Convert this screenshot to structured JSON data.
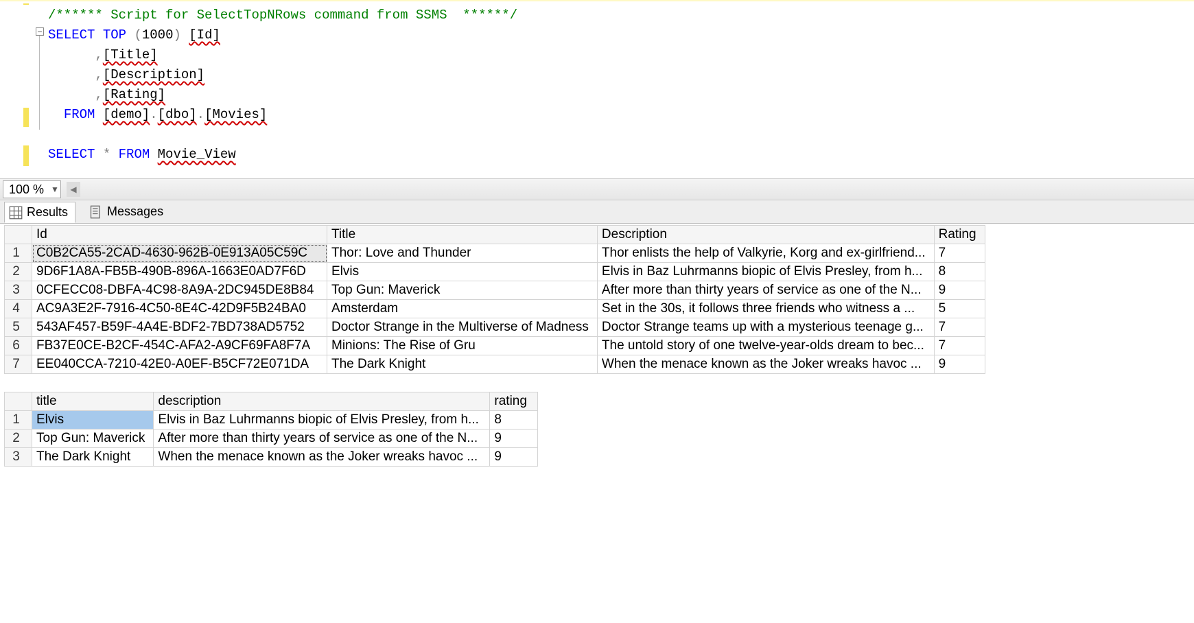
{
  "editor": {
    "lines": [
      {
        "seg": [
          {
            "t": "/****** Script for SelectTopNRows command from SSMS  ******/",
            "c": "cmt"
          }
        ]
      },
      {
        "seg": [
          {
            "t": "SELECT",
            "c": "kw"
          },
          {
            "t": " ",
            "c": "txt"
          },
          {
            "t": "TOP",
            "c": "kw"
          },
          {
            "t": " ",
            "c": "txt"
          },
          {
            "t": "(",
            "c": "op"
          },
          {
            "t": "1000",
            "c": "txt"
          },
          {
            "t": ")",
            "c": "op"
          },
          {
            "t": " ",
            "c": "txt"
          },
          {
            "t": "[Id]",
            "c": "txt squig"
          }
        ]
      },
      {
        "seg": [
          {
            "t": "      ",
            "c": "txt"
          },
          {
            "t": ",",
            "c": "op"
          },
          {
            "t": "[Title]",
            "c": "txt squig"
          }
        ]
      },
      {
        "seg": [
          {
            "t": "      ",
            "c": "txt"
          },
          {
            "t": ",",
            "c": "op"
          },
          {
            "t": "[Description]",
            "c": "txt squig"
          }
        ]
      },
      {
        "seg": [
          {
            "t": "      ",
            "c": "txt"
          },
          {
            "t": ",",
            "c": "op"
          },
          {
            "t": "[Rating]",
            "c": "txt squig"
          }
        ]
      },
      {
        "seg": [
          {
            "t": "  ",
            "c": "txt"
          },
          {
            "t": "FROM",
            "c": "kw"
          },
          {
            "t": " ",
            "c": "txt"
          },
          {
            "t": "[demo]",
            "c": "txt squig"
          },
          {
            "t": ".",
            "c": "op"
          },
          {
            "t": "[dbo]",
            "c": "txt squig"
          },
          {
            "t": ".",
            "c": "op"
          },
          {
            "t": "[Movies]",
            "c": "txt squig"
          }
        ]
      },
      {
        "seg": [
          {
            "t": " ",
            "c": "txt"
          }
        ]
      },
      {
        "seg": [
          {
            "t": "SELECT",
            "c": "kw"
          },
          {
            "t": " ",
            "c": "txt"
          },
          {
            "t": "*",
            "c": "op"
          },
          {
            "t": " ",
            "c": "txt"
          },
          {
            "t": "FROM",
            "c": "kw"
          },
          {
            "t": " ",
            "c": "txt"
          },
          {
            "t": "Movie_View",
            "c": "txt squig"
          }
        ]
      }
    ]
  },
  "zoom": {
    "value": "100 %"
  },
  "tabs": {
    "results": "Results",
    "messages": "Messages"
  },
  "grid1": {
    "headers": {
      "id": "Id",
      "title": "Title",
      "desc": "Description",
      "rating": "Rating"
    },
    "rows": [
      {
        "n": "1",
        "id": "C0B2CA55-2CAD-4630-962B-0E913A05C59C",
        "title": "Thor: Love and Thunder",
        "desc": "Thor enlists the help of Valkyrie, Korg and ex-girlfriend...",
        "rating": "7"
      },
      {
        "n": "2",
        "id": "9D6F1A8A-FB5B-490B-896A-1663E0AD7F6D",
        "title": "Elvis",
        "desc": "Elvis in Baz Luhrmanns biopic of Elvis Presley, from h...",
        "rating": "8"
      },
      {
        "n": "3",
        "id": "0CFECC08-DBFA-4C98-8A9A-2DC945DE8B84",
        "title": "Top Gun: Maverick",
        "desc": "After more than thirty years of service as one of the N...",
        "rating": "9"
      },
      {
        "n": "4",
        "id": "AC9A3E2F-7916-4C50-8E4C-42D9F5B24BA0",
        "title": "Amsterdam",
        "desc": "Set in the 30s, it follows three friends who witness a ...",
        "rating": "5"
      },
      {
        "n": "5",
        "id": "543AF457-B59F-4A4E-BDF2-7BD738AD5752",
        "title": "Doctor Strange in the Multiverse of Madness",
        "desc": "Doctor Strange teams up with a mysterious teenage g...",
        "rating": "7"
      },
      {
        "n": "6",
        "id": "FB37E0CE-B2CF-454C-AFA2-A9CF69FA8F7A",
        "title": "Minions: The Rise of Gru",
        "desc": "The untold story of one twelve-year-olds dream to bec...",
        "rating": "7"
      },
      {
        "n": "7",
        "id": "EE040CCA-7210-42E0-A0EF-B5CF72E071DA",
        "title": "The Dark Knight",
        "desc": "When the menace known as the Joker wreaks havoc ...",
        "rating": "9"
      }
    ]
  },
  "grid2": {
    "headers": {
      "title": "title",
      "desc": "description",
      "rating": "rating"
    },
    "rows": [
      {
        "n": "1",
        "title": "Elvis",
        "desc": "Elvis in Baz Luhrmanns biopic of Elvis Presley, from h...",
        "rating": "8"
      },
      {
        "n": "2",
        "title": "Top Gun: Maverick",
        "desc": "After more than thirty years of service as one of the N...",
        "rating": "9"
      },
      {
        "n": "3",
        "title": "The Dark Knight",
        "desc": "When the menace known as the Joker wreaks havoc ...",
        "rating": "9"
      }
    ]
  }
}
